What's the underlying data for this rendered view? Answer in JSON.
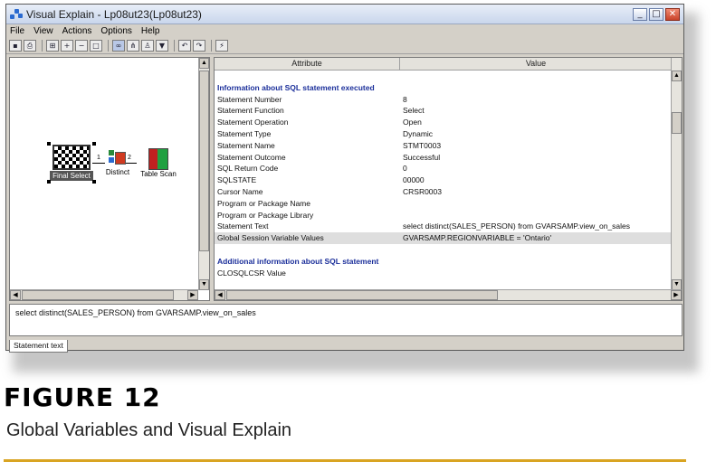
{
  "window": {
    "title": "Visual Explain - Lp08ut23(Lp08ut23)",
    "controls": {
      "minimize": "_",
      "maximize": "□",
      "close": "✕"
    }
  },
  "menu": [
    "File",
    "View",
    "Actions",
    "Options",
    "Help"
  ],
  "toolbar_icons": [
    "save-icon",
    "print-icon",
    "zoom-fit-icon",
    "zoom-in-icon",
    "zoom-out-icon",
    "zoom-box-icon",
    "overview-icon",
    "graph-icon",
    "user-icon",
    "filter-icon",
    "undo-icon",
    "redo-icon",
    "refresh-icon"
  ],
  "graph": {
    "nodes": [
      {
        "id": "final",
        "label": "Final Select"
      },
      {
        "id": "distinct",
        "label": "Distinct"
      },
      {
        "id": "scan",
        "label": "Table Scan"
      }
    ],
    "edges": [
      {
        "label": "1"
      },
      {
        "label": "2"
      }
    ]
  },
  "grid": {
    "headers": {
      "attribute": "Attribute",
      "value": "Value"
    },
    "rows": [
      {
        "attr": "",
        "value": "",
        "type": "blank"
      },
      {
        "attr": "Information about SQL statement executed",
        "value": "",
        "type": "section"
      },
      {
        "attr": "Statement Number",
        "value": "8"
      },
      {
        "attr": "Statement Function",
        "value": "Select"
      },
      {
        "attr": "Statement Operation",
        "value": "Open"
      },
      {
        "attr": "Statement Type",
        "value": "Dynamic"
      },
      {
        "attr": "Statement Name",
        "value": "STMT0003"
      },
      {
        "attr": "Statement Outcome",
        "value": "Successful"
      },
      {
        "attr": "SQL Return Code",
        "value": "0"
      },
      {
        "attr": "SQLSTATE",
        "value": "00000"
      },
      {
        "attr": "Cursor Name",
        "value": "CRSR0003"
      },
      {
        "attr": "Program or Package Name",
        "value": ""
      },
      {
        "attr": "Program or Package Library",
        "value": ""
      },
      {
        "attr": "Statement Text",
        "value": "select distinct(SALES_PERSON) from GVARSAMP.view_on_sales"
      },
      {
        "attr": "Global Session Variable Values",
        "value": "GVARSAMP.REGIONVARIABLE = 'Ontario'",
        "type": "highlight"
      },
      {
        "attr": "",
        "value": "",
        "type": "blank"
      },
      {
        "attr": "Additional information about SQL statement",
        "value": "",
        "type": "section"
      },
      {
        "attr": "CLOSQLCSR Value",
        "value": ""
      }
    ]
  },
  "statement_text": {
    "content": "select distinct(SALES_PERSON) from GVARSAMP.view_on_sales",
    "tab_label": "Statement text"
  },
  "figure": {
    "title": "FIGURE 12",
    "caption": "Global Variables and Visual Explain"
  },
  "colors": {
    "section_text": "#1a2e9a",
    "gold_rule": "#d9a422",
    "highlight_row": "#dedede"
  }
}
